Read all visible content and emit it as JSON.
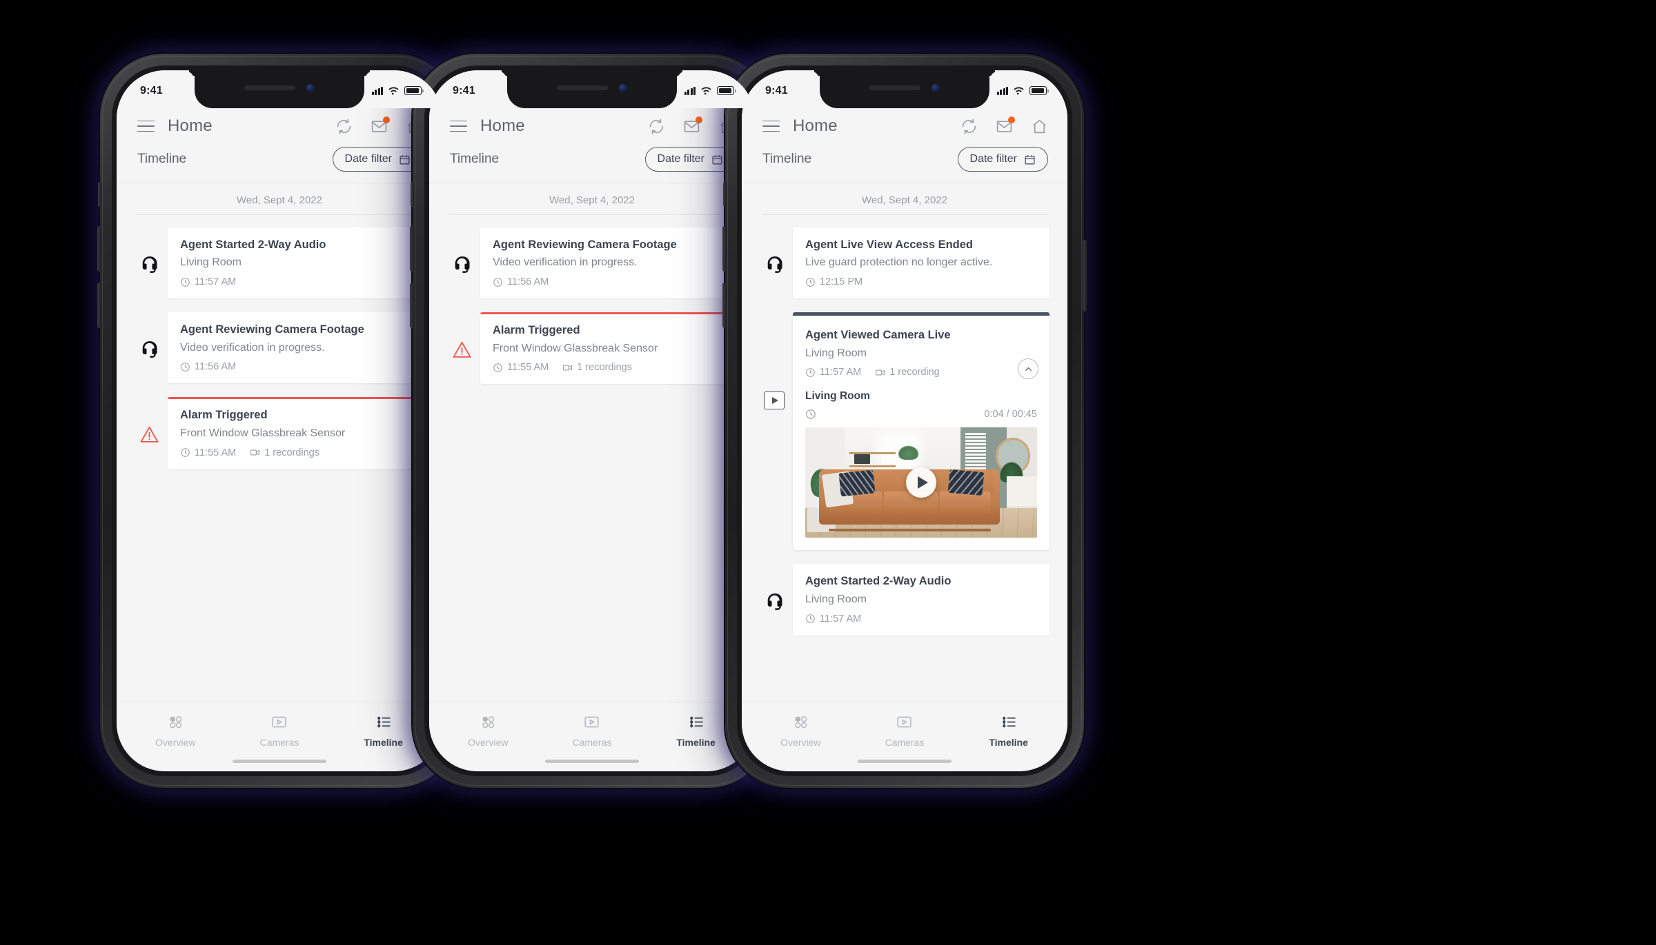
{
  "app": {
    "title": "Home",
    "section_title": "Timeline",
    "date_filter_label": "Date filter",
    "date_header": "Wed, Sept 4, 2022",
    "accent_orange": "#f4631e",
    "alarm_red": "#f0544f",
    "expanded_border": "#4b5263",
    "text_dark": "#3c4450",
    "text_muted": "#80858d",
    "text_light": "#9a9ea6",
    "screen_bg": "#f5f5f5",
    "card_bg": "#ffffff"
  },
  "statusbar": {
    "time": "9:41",
    "icons": [
      "signal-icon",
      "wifi-icon",
      "battery-icon"
    ]
  },
  "header_icons": [
    {
      "name": "refresh-icon",
      "badge": false
    },
    {
      "name": "mail-icon",
      "badge": true
    },
    {
      "name": "home-icon",
      "badge": false
    }
  ],
  "bottom_nav": [
    {
      "label": "Overview",
      "icon": "overview-icon",
      "active": false
    },
    {
      "label": "Cameras",
      "icon": "camera-play-icon",
      "active": false
    },
    {
      "label": "Timeline",
      "icon": "timeline-list-icon",
      "active": true
    }
  ],
  "phones": [
    {
      "id": "phone-1",
      "events": [
        {
          "icon": "headset-icon",
          "type": "normal",
          "title": "Agent Started 2-Way Audio",
          "subtitle": "Living Room",
          "time": "11:57 AM",
          "recordings": null
        },
        {
          "icon": "headset-icon",
          "type": "normal",
          "title": "Agent Reviewing Camera Footage",
          "subtitle": "Video verification in progress.",
          "time": "11:56 AM",
          "recordings": null
        },
        {
          "icon": "alarm-triangle-icon",
          "type": "alarm",
          "title": "Alarm Triggered",
          "subtitle": "Front Window Glassbreak Sensor",
          "time": "11:55 AM",
          "recordings": "1 recordings"
        }
      ]
    },
    {
      "id": "phone-2",
      "events": [
        {
          "icon": "headset-icon",
          "type": "normal",
          "title": "Agent Reviewing Camera Footage",
          "subtitle": "Video verification in progress.",
          "time": "11:56 AM",
          "recordings": null
        },
        {
          "icon": "alarm-triangle-icon",
          "type": "alarm",
          "title": "Alarm Triggered",
          "subtitle": "Front Window Glassbreak Sensor",
          "time": "11:55 AM",
          "recordings": "1 recordings"
        }
      ]
    },
    {
      "id": "phone-3",
      "events": [
        {
          "icon": "headset-icon",
          "type": "normal",
          "title": "Agent Live View Access Ended",
          "subtitle": "Live guard protection no longer active.",
          "time": "12:15 PM",
          "recordings": null
        },
        {
          "icon": "play-box-icon",
          "type": "expanded",
          "title": "Agent Viewed Camera Live",
          "subtitle": "Living Room",
          "time": "11:57 AM",
          "recordings": "1 recording",
          "clip": {
            "title": "Living Room",
            "elapsed_total": "0:04 / 00:45",
            "play_label": "play-button",
            "collapse_label": "chevron-up-icon"
          }
        },
        {
          "icon": "headset-icon",
          "type": "normal",
          "title": "Agent Started 2-Way Audio",
          "subtitle": "Living Room",
          "time": "11:57 AM",
          "recordings": null
        }
      ]
    }
  ]
}
